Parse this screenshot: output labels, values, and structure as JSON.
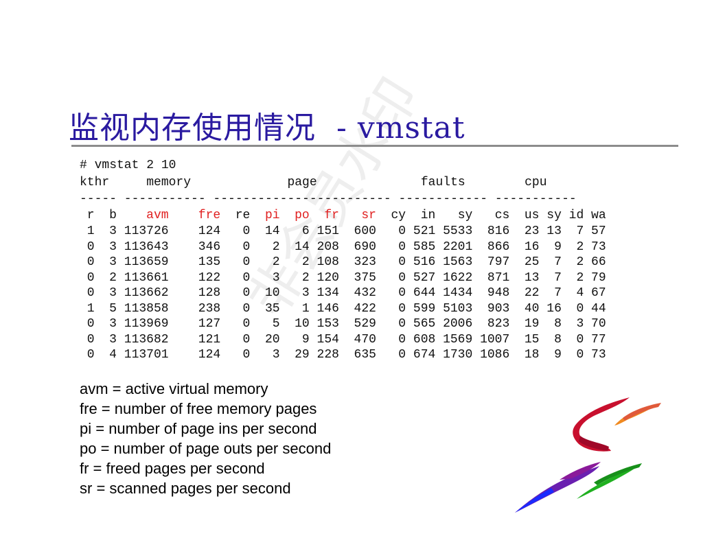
{
  "title": "监视内存使用情况  - vmstat",
  "watermark": "非会员水印",
  "command": "# vmstat 2 10",
  "groups": "kthr     memory             page              faults        cpu",
  "dashes": "----- ----------- ------------------------ ------------ -----------",
  "columns": [
    {
      "label": "r",
      "highlight": false
    },
    {
      "label": "b",
      "highlight": false
    },
    {
      "label": "avm",
      "highlight": true
    },
    {
      "label": "fre",
      "highlight": true
    },
    {
      "label": "re",
      "highlight": false
    },
    {
      "label": "pi",
      "highlight": true
    },
    {
      "label": "po",
      "highlight": true
    },
    {
      "label": "fr",
      "highlight": true
    },
    {
      "label": "sr",
      "highlight": true
    },
    {
      "label": "cy",
      "highlight": false
    },
    {
      "label": "in",
      "highlight": false
    },
    {
      "label": "sy",
      "highlight": false
    },
    {
      "label": "cs",
      "highlight": false
    },
    {
      "label": "us",
      "highlight": false
    },
    {
      "label": "sy",
      "highlight": false
    },
    {
      "label": "id",
      "highlight": false
    },
    {
      "label": "wa",
      "highlight": false
    }
  ],
  "rows": [
    [
      "1",
      "3",
      "113726",
      "124",
      "0",
      "14",
      "6",
      "151",
      "600",
      "0",
      "521",
      "5533",
      "816",
      "23",
      "13",
      "7",
      "57"
    ],
    [
      "0",
      "3",
      "113643",
      "346",
      "0",
      "2",
      "14",
      "208",
      "690",
      "0",
      "585",
      "2201",
      "866",
      "16",
      "9",
      "2",
      "73"
    ],
    [
      "0",
      "3",
      "113659",
      "135",
      "0",
      "2",
      "2",
      "108",
      "323",
      "0",
      "516",
      "1563",
      "797",
      "25",
      "7",
      "2",
      "66"
    ],
    [
      "0",
      "2",
      "113661",
      "122",
      "0",
      "3",
      "2",
      "120",
      "375",
      "0",
      "527",
      "1622",
      "871",
      "13",
      "7",
      "2",
      "79"
    ],
    [
      "0",
      "3",
      "113662",
      "128",
      "0",
      "10",
      "3",
      "134",
      "432",
      "0",
      "644",
      "1434",
      "948",
      "22",
      "7",
      "4",
      "67"
    ],
    [
      "1",
      "5",
      "113858",
      "238",
      "0",
      "35",
      "1",
      "146",
      "422",
      "0",
      "599",
      "5103",
      "903",
      "40",
      "16",
      "0",
      "44"
    ],
    [
      "0",
      "3",
      "113969",
      "127",
      "0",
      "5",
      "10",
      "153",
      "529",
      "0",
      "565",
      "2006",
      "823",
      "19",
      "8",
      "3",
      "70"
    ],
    [
      "0",
      "3",
      "113682",
      "121",
      "0",
      "20",
      "9",
      "154",
      "470",
      "0",
      "608",
      "1569",
      "1007",
      "15",
      "8",
      "0",
      "77"
    ],
    [
      "0",
      "4",
      "113701",
      "124",
      "0",
      "3",
      "29",
      "228",
      "635",
      "0",
      "674",
      "1730",
      "1086",
      "18",
      "9",
      "0",
      "73"
    ]
  ],
  "legend": [
    "avm = active virtual memory",
    "fre = number of free memory pages",
    "pi = number of page ins per second",
    "po = number of page outs per second",
    "fr = freed pages per second",
    "sr = scanned pages per second"
  ],
  "colors": {
    "title": "#2a1aa0",
    "highlight": "#e02020",
    "rule": "#8c8c8c"
  },
  "logo_icon": "ribbon-s-logo"
}
